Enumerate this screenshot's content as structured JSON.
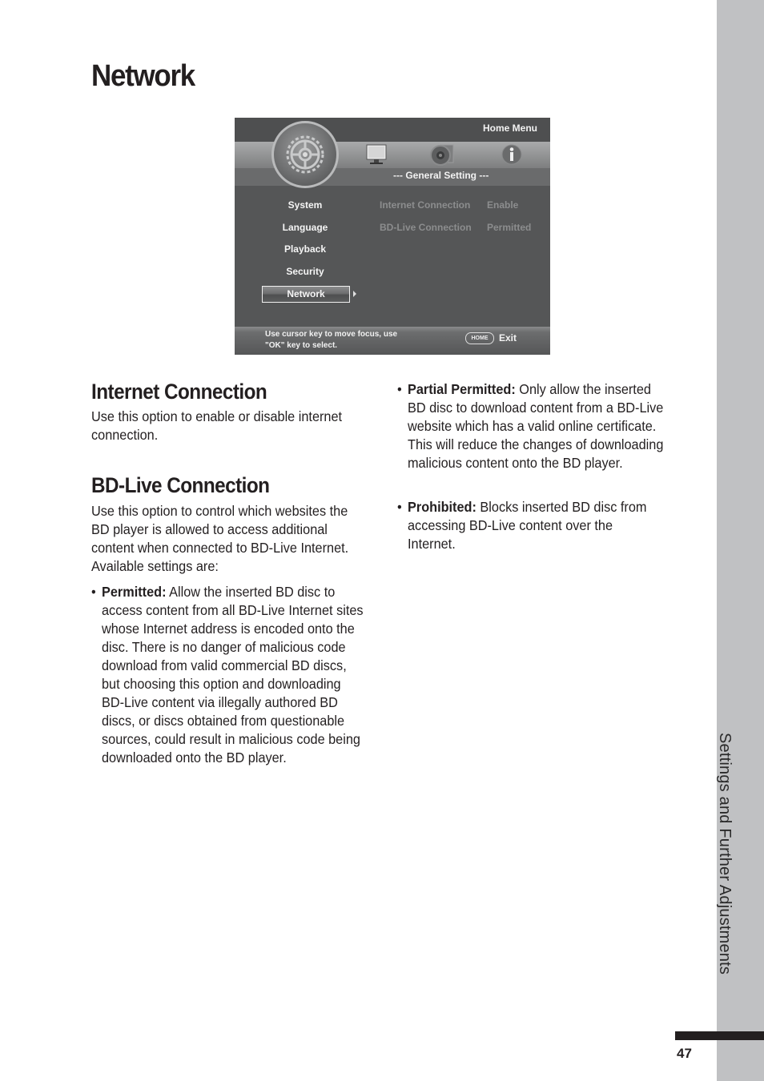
{
  "page": {
    "title": "Network",
    "section_tab": "Settings and Further Adjustments",
    "page_number": "47"
  },
  "menu_screen": {
    "header": "Home Menu",
    "subheader": "--- General Setting ---",
    "icons": [
      "gear-icon",
      "monitor-icon",
      "music-icon",
      "info-icon"
    ],
    "categories": [
      {
        "label": "System",
        "selected": false
      },
      {
        "label": "Language",
        "selected": false
      },
      {
        "label": "Playback",
        "selected": false
      },
      {
        "label": "Security",
        "selected": false
      },
      {
        "label": "Network",
        "selected": true
      }
    ],
    "options": [
      {
        "name": "Internet Connection",
        "value": "Enable"
      },
      {
        "name": "BD-Live Connection",
        "value": "Permitted"
      }
    ],
    "hint_line1": "Use cursor key to move focus, use",
    "hint_line2": "\"OK\" key to select.",
    "home_button": "HOME",
    "exit_label": "Exit"
  },
  "sections": {
    "internet": {
      "heading": "Internet Connection",
      "body": "Use this option to enable or disable internet connection."
    },
    "bdlive": {
      "heading": "BD-Live Connection",
      "body": "Use this option to control which websites the BD player is allowed to access additional content when connected to BD-Live Internet. Available settings are:",
      "bullets": [
        {
          "term": "Permitted:",
          "text": " Allow the inserted BD disc to access content from all BD-Live Internet sites whose Internet address is encoded onto the disc. There is no danger of malicious code download from valid commercial BD discs, but choosing this option and downloading BD-Live content via illegally authored BD discs, or discs obtained from questionable sources, could result in malicious code being downloaded onto the BD player."
        },
        {
          "term": "Partial Permitted:",
          "text": " Only allow the inserted BD disc to download content from a BD-Live website which has a valid online certificate. This will reduce the changes of downloading malicious content onto the BD player."
        },
        {
          "term": "Prohibited:",
          "text": " Blocks inserted BD disc from accessing BD-Live content over the Internet."
        }
      ]
    }
  }
}
